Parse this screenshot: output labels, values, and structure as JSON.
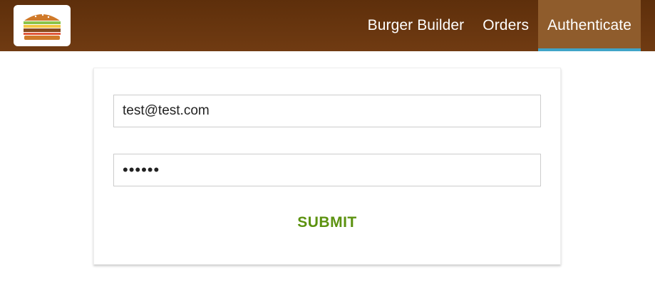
{
  "header": {
    "logo_icon": "burger-logo-icon",
    "nav": [
      {
        "label": "Burger Builder",
        "active": false
      },
      {
        "label": "Orders",
        "active": false
      },
      {
        "label": "Authenticate",
        "active": true
      }
    ]
  },
  "auth_form": {
    "email": {
      "value": "test@test.com"
    },
    "password": {
      "value": "••••••"
    },
    "submit_label": "SUBMIT"
  },
  "colors": {
    "toolbar": "#703b12",
    "active_nav": "#8f5c2c",
    "active_underline": "#40a4c8",
    "submit": "#5c9210"
  }
}
